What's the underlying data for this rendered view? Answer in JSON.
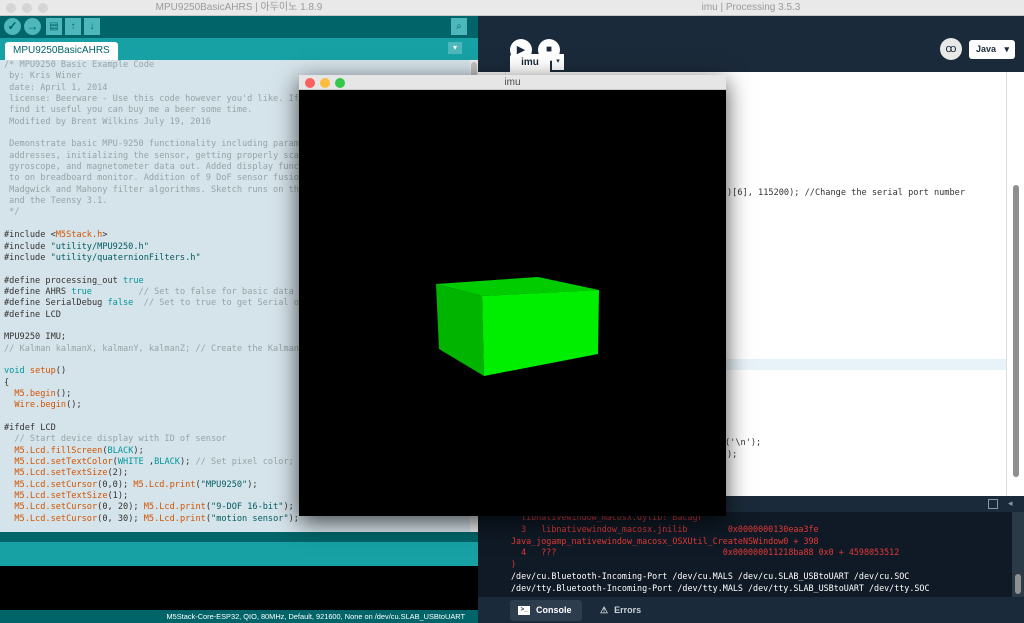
{
  "arduino": {
    "title": "MPU9250BasicAHRS | 아두이노 1.8.9",
    "toolbar": {
      "verify_glyph": "✓",
      "upload_glyph": "→",
      "new_glyph": "▤",
      "open_glyph": "↑",
      "save_glyph": "↓",
      "monitor_glyph": "⌕"
    },
    "tab_label": "MPU9250BasicAHRS",
    "tab_menu_glyph": "▾",
    "status": "M5Stack-Core-ESP32, QIO, 80MHz, Default, 921600, None on /dev/cu.SLAB_USBtoUART",
    "code_lines": [
      "/* MPU9250 Basic Example Code",
      " by: Kris Winer",
      " date: April 1, 2014",
      " license: Beerware - Use this code however you'd like. If you",
      " find it useful you can buy me a beer some time.",
      " Modified by Brent Wilkins July 19, 2016",
      "",
      " Demonstrate basic MPU-9250 functionality including paramet",
      " addresses, initializing the sensor, getting properly scale",
      " gyroscope, and magnetometer data out. Added display functi",
      " to on breadboard monitor. Addition of 9 DoF sensor fusion",
      " Madgwick and Mahony filter algorithms. Sketch runs on the",
      " and the Teensy 3.1.",
      " */",
      "",
      "#include <M5Stack.h>",
      "#include \"utility/MPU9250.h\"",
      "#include \"utility/quaternionFilters.h\"",
      "",
      "#define processing_out true",
      "#define AHRS true         // Set to false for basic data re",
      "#define SerialDebug false  // Set to true to get Serial out",
      "#define LCD",
      "",
      "MPU9250 IMU;",
      "// Kalman kalmanX, kalmanY, kalmanZ; // Create the Kalman i",
      "",
      "void setup()",
      "{",
      "  M5.begin();",
      "  Wire.begin();",
      "",
      "#ifdef LCD",
      "  // Start device display with ID of sensor",
      "  M5.Lcd.fillScreen(BLACK);",
      "  M5.Lcd.setTextColor(WHITE ,BLACK); // Set pixel color; 1 o",
      "  M5.Lcd.setTextSize(2);",
      "  M5.Lcd.setCursor(0,0); M5.Lcd.print(\"MPU9250\");",
      "  M5.Lcd.setTextSize(1);",
      "  M5.Lcd.setCursor(0, 20); M5.Lcd.print(\"9-DOF 16-bit\");",
      "  M5.Lcd.setCursor(0, 30); M5.Lcd.print(\"motion sensor\");"
    ]
  },
  "processing": {
    "title": "imu | Processing 3.5.3",
    "run_glyph": "▶",
    "stop_glyph": "■",
    "debug_glyph": "ꝏ",
    "mode_label": "Java",
    "mode_caret": "▾",
    "tab_label": "imu",
    "tab_menu_glyph": "▾",
    "code_fragments": [
      ")[6], 115200); //Change the serial port number",
      "('\\n');",
      ");"
    ],
    "console_lines": [
      {
        "text": "  libnativewindow_macosx.dylib: Bacagr",
        "kind": "err"
      },
      {
        "text": "  3   libnativewindow_macosx.jnilib        0x0000000130eaa3fe",
        "kind": "err"
      },
      {
        "text": "Java_jogamp_nativewindow_macosx_OSXUtil_CreateNSWindow0 + 398",
        "kind": "err"
      },
      {
        "text": "  4   ???                                 0x000000011218ba88 0x0 + 4598053512",
        "kind": "err"
      },
      {
        "text": ")",
        "kind": "err"
      },
      {
        "text": "/dev/cu.Bluetooth-Incoming-Port /dev/cu.MALS /dev/cu.SLAB_USBtoUART /dev/cu.SOC",
        "kind": "out"
      },
      {
        "text": "/dev/tty.Bluetooth-Incoming-Port /dev/tty.MALS /dev/tty.SLAB_USBtoUART /dev/tty.SOC",
        "kind": "out"
      }
    ],
    "console_tab": "Console",
    "errors_tab": "Errors"
  },
  "imu_window": {
    "title": "imu",
    "box_color_front": "#00ee00",
    "box_color_top": "#00cc00",
    "box_color_side": "#00b400"
  },
  "colors": {
    "arduino_teal": "#00878f",
    "processing_navy": "#1b2a3a",
    "console_error": "#e53935"
  }
}
